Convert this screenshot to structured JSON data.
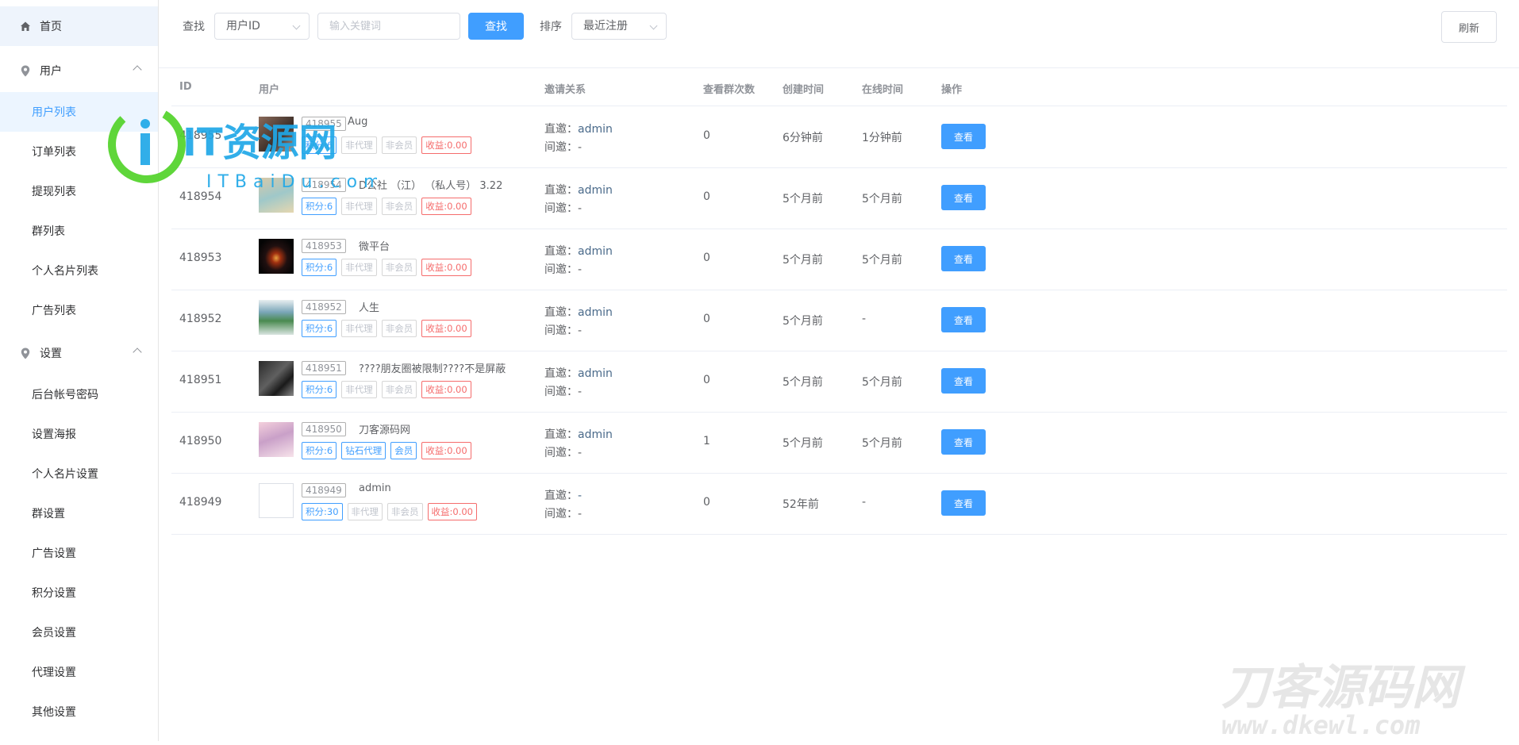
{
  "sidebar": {
    "home": "首页",
    "user_group": "用户",
    "user_items": [
      "用户列表",
      "订单列表",
      "提现列表",
      "群列表",
      "个人名片列表",
      "广告列表"
    ],
    "settings_group": "设置",
    "settings_items": [
      "后台帐号密码",
      "设置海报",
      "个人名片设置",
      "群设置",
      "广告设置",
      "积分设置",
      "会员设置",
      "代理设置",
      "其他设置"
    ]
  },
  "toolbar": {
    "search_label": "查找",
    "search_field": "用户ID",
    "keyword_placeholder": "输入关键词",
    "search_button": "查找",
    "sort_label": "排序",
    "sort_value": "最近注册",
    "refresh_button": "刷新"
  },
  "table": {
    "headers": [
      "ID",
      "用户",
      "邀请关系",
      "查看群次数",
      "创建时间",
      "在线时间",
      "操作"
    ],
    "direct_label": "直邀：",
    "indirect_label": "间邀：",
    "view_label": "查看",
    "rows": [
      {
        "id": "418955",
        "uid_tag": "418955",
        "name": "Aug",
        "tags": [
          "积分:6",
          "非代理",
          "非会员",
          "收益:0.00"
        ],
        "direct": "admin",
        "indirect": "-",
        "views": "0",
        "created": "6分钟前",
        "online": "1分钟前"
      },
      {
        "id": "418954",
        "uid_tag": "418954",
        "name": "D公社 （江） （私人号） 3.22",
        "tags": [
          "积分:6",
          "非代理",
          "非会员",
          "收益:0.00"
        ],
        "direct": "admin",
        "indirect": "-",
        "views": "0",
        "created": "5个月前",
        "online": "5个月前"
      },
      {
        "id": "418953",
        "uid_tag": "418953",
        "name": "微平台",
        "tags": [
          "积分:6",
          "非代理",
          "非会员",
          "收益:0.00"
        ],
        "direct": "admin",
        "indirect": "-",
        "views": "0",
        "created": "5个月前",
        "online": "5个月前"
      },
      {
        "id": "418952",
        "uid_tag": "418952",
        "name": "人生",
        "tags": [
          "积分:6",
          "非代理",
          "非会员",
          "收益:0.00"
        ],
        "direct": "admin",
        "indirect": "-",
        "views": "0",
        "created": "5个月前",
        "online": "-"
      },
      {
        "id": "418951",
        "uid_tag": "418951",
        "name": "????朋友圈被限制????不是屏蔽",
        "tags": [
          "积分:6",
          "非代理",
          "非会员",
          "收益:0.00"
        ],
        "direct": "admin",
        "indirect": "-",
        "views": "0",
        "created": "5个月前",
        "online": "5个月前"
      },
      {
        "id": "418950",
        "uid_tag": "418950",
        "name": "刀客源码网",
        "tags": [
          "积分:6",
          "钻石代理",
          "会员",
          "收益:0.00"
        ],
        "direct": "admin",
        "indirect": "-",
        "views": "1",
        "created": "5个月前",
        "online": "5个月前"
      },
      {
        "id": "418949",
        "uid_tag": "418949",
        "name": "admin",
        "tags": [
          "积分:30",
          "非代理",
          "非会员",
          "收益:0.00"
        ],
        "direct": "-",
        "indirect": "-",
        "views": "0",
        "created": "52年前",
        "online": "-"
      }
    ]
  },
  "watermarks": {
    "itbaidu_title": "IT资源网",
    "itbaidu_sub": "ITBaiDu.com",
    "dkewl_title": "刀客源码网",
    "dkewl_sub": "www.dkewl.com"
  },
  "colors": {
    "accent": "#409eff",
    "danger": "#f56c6c",
    "active_bg": "#ecf5ff"
  }
}
